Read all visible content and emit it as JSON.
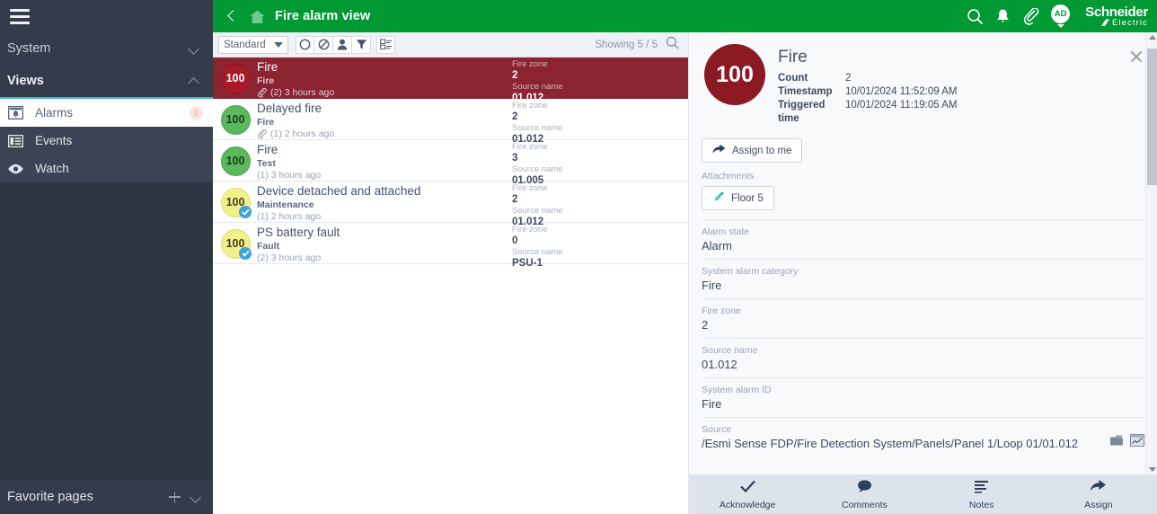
{
  "sidebar": {
    "menu_icon": "hamburger-icon",
    "sections": [
      {
        "label": "System",
        "expanded": false
      },
      {
        "label": "Views",
        "expanded": true
      }
    ],
    "items": [
      {
        "label": "Alarms",
        "icon": "alarm-bell-icon",
        "active": true,
        "badge": "2"
      },
      {
        "label": "Events",
        "icon": "events-list-icon",
        "active": false,
        "badge": ""
      },
      {
        "label": "Watch",
        "icon": "eye-icon",
        "active": false,
        "badge": ""
      }
    ],
    "favorites": {
      "label": "Favorite pages",
      "add_icon": "plus-icon",
      "chevron_icon": "chevron-down-icon"
    }
  },
  "topbar": {
    "back_icon": "back-arrow-icon",
    "home_icon": "home-icon",
    "title": "Fire alarm view",
    "icons": [
      {
        "name": "search-icon"
      },
      {
        "name": "bell-icon"
      },
      {
        "name": "paperclip-icon"
      }
    ],
    "avatar_initials": "AD",
    "brand_line1": "Schneider",
    "brand_line2": "Electric",
    "accent_green": "#009933"
  },
  "toolbar": {
    "view_select": "Standard",
    "buttons": [
      {
        "name": "circle-filter-button"
      },
      {
        "name": "disabled-filter-button"
      },
      {
        "name": "person-filter-button"
      },
      {
        "name": "funnel-filter-button"
      },
      {
        "name": "column-settings-button"
      }
    ],
    "showing": "Showing 5 / 5",
    "search_icon": "search-icon"
  },
  "alarm_list": {
    "field_labels": {
      "zone": "Fire zone",
      "source": "Source name"
    },
    "rows": [
      {
        "priority": "100",
        "color": "red",
        "acknowledged": false,
        "selected": true,
        "title": "Fire",
        "category": "Fire",
        "has_attachment": true,
        "meta": "(2) 3 hours ago",
        "fire_zone": "2",
        "source_name": "01.012"
      },
      {
        "priority": "100",
        "color": "green",
        "acknowledged": false,
        "selected": false,
        "title": "Delayed fire",
        "category": "Fire",
        "has_attachment": true,
        "meta": "(1) 2 hours ago",
        "fire_zone": "2",
        "source_name": "01.012"
      },
      {
        "priority": "100",
        "color": "green",
        "acknowledged": false,
        "selected": false,
        "title": "Fire",
        "category": "Test",
        "has_attachment": false,
        "meta": "(1) 3 hours ago",
        "fire_zone": "3",
        "source_name": "01.005"
      },
      {
        "priority": "100",
        "color": "yellow",
        "acknowledged": true,
        "selected": false,
        "title": "Device detached and attached",
        "category": "Maintenance",
        "has_attachment": false,
        "meta": "(1) 2 hours ago",
        "fire_zone": "2",
        "source_name": "01.012"
      },
      {
        "priority": "100",
        "color": "yellow",
        "acknowledged": true,
        "selected": false,
        "title": "PS battery fault",
        "category": "Fault",
        "has_attachment": false,
        "meta": "(2) 3 hours ago",
        "fire_zone": "0",
        "source_name": "PSU-1"
      }
    ]
  },
  "detail": {
    "priority": "100",
    "title": "Fire",
    "close_icon": "close-icon",
    "summary": [
      {
        "key": "Count",
        "value": "2"
      },
      {
        "key": "Timestamp",
        "value": "10/01/2024 11:52:09 AM"
      },
      {
        "key": "Triggered time",
        "value": "10/01/2024 11:19:05 AM"
      }
    ],
    "assign_button": {
      "label": "Assign to me",
      "icon": "assign-arrow-icon"
    },
    "attachments_label": "Attachments",
    "attachments": [
      {
        "label": "Floor 5",
        "icon": "pen-icon"
      }
    ],
    "fields": [
      {
        "label": "Alarm state",
        "value": "Alarm"
      },
      {
        "label": "System alarm category",
        "value": "Fire"
      },
      {
        "label": "Fire zone",
        "value": "2"
      },
      {
        "label": "Source name",
        "value": "01.012"
      },
      {
        "label": "System alarm ID",
        "value": "Fire"
      }
    ],
    "source_field": {
      "label": "Source",
      "value": "/Esmi Sense FDP/Fire Detection System/Panels/Panel 1/Loop 01/01.012",
      "icons": [
        {
          "name": "folder-icon"
        },
        {
          "name": "trend-chart-icon"
        }
      ]
    },
    "actions": [
      {
        "label": "Acknowledge",
        "icon": "check-icon"
      },
      {
        "label": "Comments",
        "icon": "comment-bubble-icon"
      },
      {
        "label": "Notes",
        "icon": "notes-lines-icon"
      },
      {
        "label": "Assign",
        "icon": "assign-arrow-icon"
      }
    ],
    "scrollbar": {
      "name": "detail-vertical-scrollbar"
    }
  }
}
